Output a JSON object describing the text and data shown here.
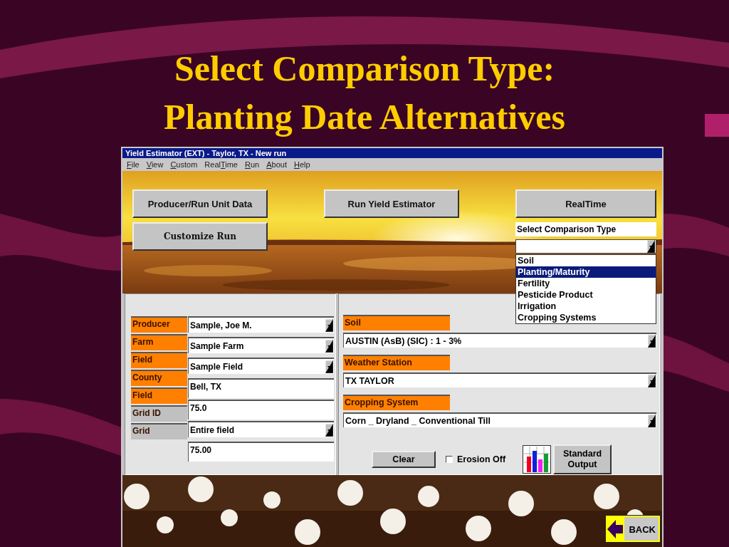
{
  "slide_title": [
    "Select Comparison Type:",
    "Planting Date Alternatives"
  ],
  "window": {
    "title": "Yield Estimator (EXT) - Taylor, TX  - New run"
  },
  "menu": [
    {
      "mnemonic": "F",
      "after": "ile"
    },
    {
      "mnemonic": "V",
      "after": "iew"
    },
    {
      "mnemonic": "C",
      "after": "ustom"
    },
    {
      "before": "Real",
      "mnemonic": "T",
      "after": "ime"
    },
    {
      "mnemonic": "R",
      "after": "un"
    },
    {
      "mnemonic": "A",
      "after": "bout"
    },
    {
      "mnemonic": "H",
      "after": "elp"
    }
  ],
  "top_buttons": [
    "Producer/Run Unit Data",
    "Customize Run",
    "Run Yield Estimator",
    "RealTime"
  ],
  "comparison": {
    "label": "Select Comparison Type",
    "options": [
      {
        "label": "Soil",
        "selected": false
      },
      {
        "label": "Planting/Maturity",
        "selected": true
      },
      {
        "label": "Fertility",
        "selected": false
      },
      {
        "label": "Pesticide Product",
        "selected": false
      },
      {
        "label": "Irrigation",
        "selected": false
      },
      {
        "label": "Cropping Systems",
        "selected": false
      }
    ]
  },
  "left_labels": [
    {
      "label": "Producer",
      "color": "#ff8000"
    },
    {
      "label": "Farm",
      "color": "#ff8000"
    },
    {
      "label": "Field",
      "color": "#ff8000"
    },
    {
      "label": "County",
      "color": "#ff8000"
    },
    {
      "label": "Field",
      "color": "#ff8000"
    },
    {
      "label": "Grid ID",
      "color": "#c0c0c0"
    },
    {
      "label": "Grid",
      "color": "#c0c0c0"
    }
  ],
  "left_fields": [
    {
      "kind": "dropdown",
      "value": "Sample, Joe M."
    },
    {
      "kind": "dropdown",
      "value": "Sample Farm"
    },
    {
      "kind": "dropdown",
      "value": "Sample Field"
    },
    {
      "kind": "text",
      "value": "Bell, TX"
    },
    {
      "kind": "text",
      "value": "75.0"
    },
    {
      "kind": "dropdown",
      "value": "Entire field"
    },
    {
      "kind": "text",
      "value": "75.00"
    }
  ],
  "right_fields": [
    {
      "label": "Soil",
      "value": "AUSTIN (AsB) (SIC) : 1 - 3%"
    },
    {
      "label": "Weather Station",
      "value": "TX TAYLOR"
    },
    {
      "label": "Cropping System",
      "value": "Corn _ Dryland _ Conventional Till"
    }
  ],
  "clear_button": "Clear",
  "erosion": {
    "label": "Erosion Off",
    "checked": false
  },
  "output_button": "Standard Output",
  "back_button": "BACK"
}
